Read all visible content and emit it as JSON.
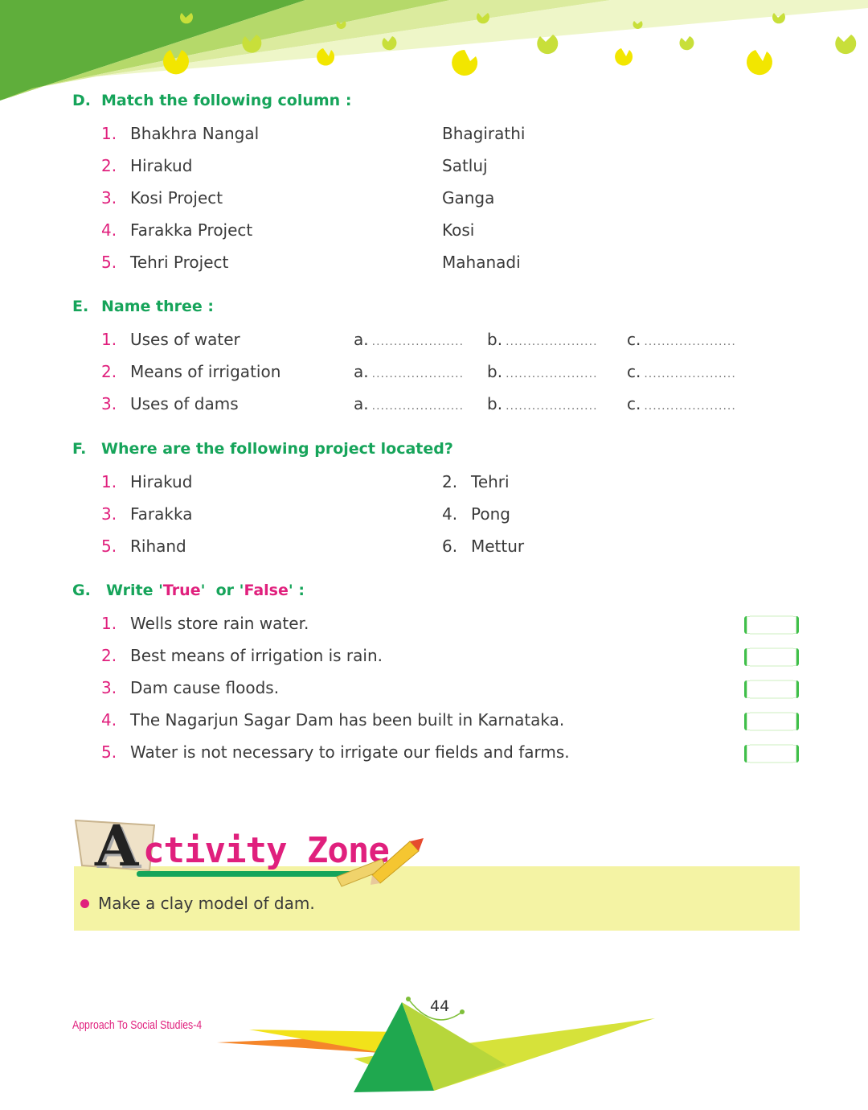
{
  "sectionD": {
    "label": "D.",
    "title": "Match the following column :",
    "items": [
      {
        "num": "1.",
        "left": "Bhakhra Nangal",
        "right": "Bhagirathi"
      },
      {
        "num": "2.",
        "left": "Hirakud",
        "right": "Satluj"
      },
      {
        "num": "3.",
        "left": "Kosi Project",
        "right": "Ganga"
      },
      {
        "num": "4.",
        "left": "Farakka Project",
        "right": "Kosi"
      },
      {
        "num": "5.",
        "left": "Tehri Project",
        "right": "Mahanadi"
      }
    ]
  },
  "sectionE": {
    "label": "E.",
    "title": "Name three :",
    "blank": ".....................",
    "opt_a": "a.",
    "opt_b": "b.",
    "opt_c": "c.",
    "items": [
      {
        "num": "1.",
        "text": "Uses of water"
      },
      {
        "num": "2.",
        "text": "Means of irrigation"
      },
      {
        "num": "3.",
        "text": "Uses of dams"
      }
    ]
  },
  "sectionF": {
    "label": "F.",
    "title": "Where are the following project located?",
    "items": [
      {
        "num": "1.",
        "text": "Hirakud"
      },
      {
        "num": "2.",
        "text": "Tehri"
      },
      {
        "num": "3.",
        "text": "Farakka"
      },
      {
        "num": "4.",
        "text": "Pong"
      },
      {
        "num": "5.",
        "text": "Rihand"
      },
      {
        "num": "6.",
        "text": "Mettur"
      }
    ]
  },
  "sectionG": {
    "label": "G.",
    "title_pre": "Write '",
    "title_true": "True",
    "title_mid": "'  or '",
    "title_false": "False",
    "title_post": "' :",
    "items": [
      {
        "num": "1.",
        "text": "Wells store rain water."
      },
      {
        "num": "2.",
        "text": "Best means of irrigation is rain."
      },
      {
        "num": "3.",
        "text": "Dam cause floods."
      },
      {
        "num": "4.",
        "text": "The Nagarjun Sagar Dam has been built in Karnataka."
      },
      {
        "num": "5.",
        "text": "Water is not necessary to irrigate our fields and farms."
      }
    ]
  },
  "activity": {
    "title_first": "A",
    "title_rest": "ctivity Zone",
    "item": "Make a clay model of dam."
  },
  "footer": {
    "book": "Approach To Social Studies-4",
    "page": "44"
  },
  "colors": {
    "heading": "#16a45a",
    "number": "#e0207d",
    "band": "#f4f3a4"
  }
}
